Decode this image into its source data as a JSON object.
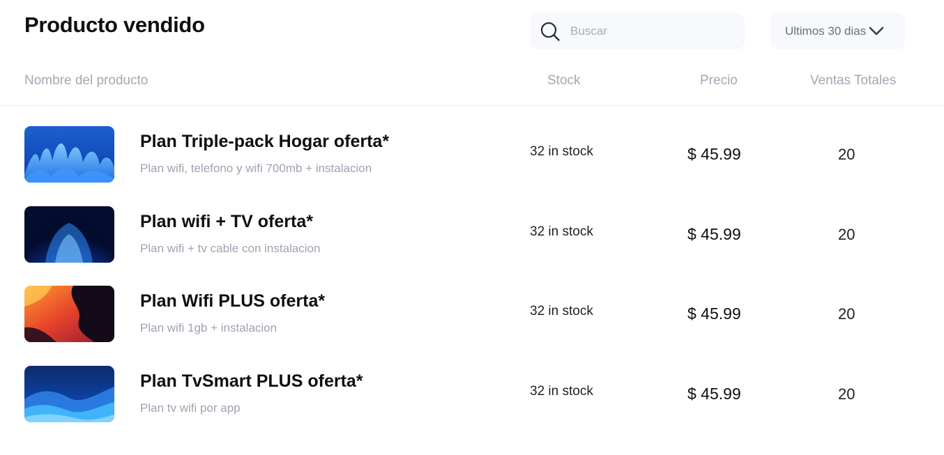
{
  "header": {
    "title": "Producto vendido",
    "search_placeholder": "Buscar",
    "period_label": "Ultimos 30 dias"
  },
  "icons": {
    "search": "search-icon",
    "dropdown": "chevron-down-icon"
  },
  "table": {
    "columns": [
      "Nombre del producto",
      "Stock",
      "Precio",
      "Ventas Totales"
    ],
    "rows": [
      {
        "name": "Plan Triple-pack Hogar oferta*",
        "description": "Plan wifi, telefono y wifi 700mb + instalacion",
        "stock": "32 in stock",
        "price": "$ 45.99",
        "sales": "20",
        "image": "blue-petals-wallpaper"
      },
      {
        "name": "Plan wifi + TV oferta*",
        "description": "Plan wifi + tv cable con instalacion",
        "stock": "32 in stock",
        "price": "$ 45.99",
        "sales": "20",
        "image": "blue-bloom-wallpaper"
      },
      {
        "name": "Plan Wifi PLUS oferta*",
        "description": "Plan wifi 1gb + instalacion",
        "stock": "32 in stock",
        "price": "$ 45.99",
        "sales": "20",
        "image": "orange-abstract-wallpaper"
      },
      {
        "name": "Plan TvSmart PLUS oferta*",
        "description": "Plan tv wifi por app",
        "stock": "32 in stock",
        "price": "$ 45.99",
        "sales": "20",
        "image": "blue-waves-wallpaper"
      }
    ]
  },
  "colors": {
    "text_primary": "#0f0f12",
    "text_muted": "#a3a7b3",
    "input_background": "#f8f9fd"
  }
}
